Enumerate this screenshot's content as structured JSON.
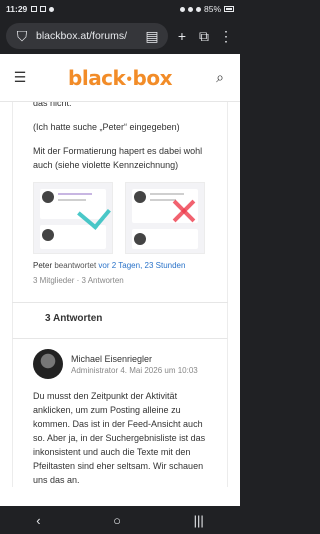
{
  "status": {
    "time": "11:29",
    "battery": "85%"
  },
  "browser": {
    "url": "blackbox.at/forums/"
  },
  "site": {
    "logo_left": "black",
    "logo_sep": "•",
    "logo_right": "box"
  },
  "post": {
    "line1": "das nicht.",
    "para1": "(Ich hatte suche „Peter“ eingegeben)",
    "para2": "Mit der Formatierung hapert es dabei wohl auch (siehe violette Kennzeichnung)",
    "author": "Peter",
    "answered": "beantwortet",
    "time_link": "vor 2 Tagen, 23 Stunden",
    "stats": "3 Mitglieder · 3 Antworten"
  },
  "answers": {
    "heading": "3 Antworten"
  },
  "reply": {
    "name": "Michael Eisenriegler",
    "role_date": "Administrator  4. Mai 2026 um 10:03",
    "body": "Du musst den Zeitpunkt der Aktivität anklicken, um zum Posting alleine zu kommen. Das ist in der Feed-Ansicht auch so. Aber ja, in der Suchergebnisliste ist das inkonsistent und auch die Texte mit den Pfeiltasten sind eher seltsam. Wir schauen uns das an."
  },
  "nav": {
    "back": "‹",
    "home": "○",
    "recents": "|||"
  }
}
